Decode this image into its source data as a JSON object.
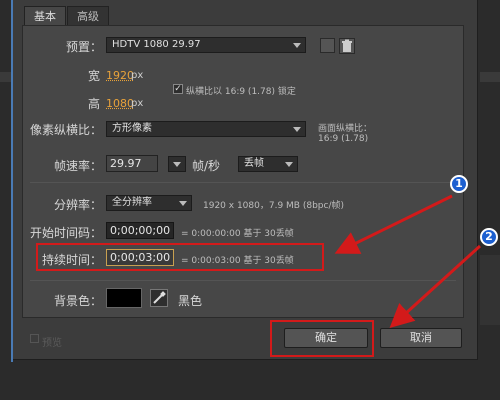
{
  "tabs": [
    "基本",
    "高级"
  ],
  "preset": {
    "label": "预置：",
    "value": "HDTV 1080 29.97"
  },
  "width": {
    "label": "宽",
    "value": "1920",
    "unit": "px"
  },
  "height": {
    "label": "高",
    "value": "1080",
    "unit": "px"
  },
  "lock_aspect": {
    "checked": "✓",
    "label": "纵横比以 16:9 (1.78) 锁定"
  },
  "pixel_aspect": {
    "label": "像素纵横比：",
    "value": "方形像素",
    "frame_aspect_label": "画面纵横比：",
    "frame_aspect_value": "16:9 (1.78)"
  },
  "frame_rate": {
    "label": "帧速率：",
    "value": "29.97",
    "unit": "帧/秒",
    "drop_frame": "丢帧"
  },
  "resolution": {
    "label": "分辨率：",
    "value": "全分辨率",
    "info": "1920 x 1080，7.9 MB (8bpc/帧)"
  },
  "start_timecode": {
    "label": "开始时间码：",
    "value": "0;00;00;00",
    "info": "= 0:00:00:00 基于 30丢帧"
  },
  "duration": {
    "label": "持续时间：",
    "value": "0;00;03;00",
    "info": "= 0:00:03:00 基于 30丢帧"
  },
  "background": {
    "label": "背景色：",
    "color": "#000000",
    "color_name": "黑色"
  },
  "preview_label": "预览",
  "buttons": {
    "ok": "确定",
    "cancel": "取消"
  },
  "annotations": {
    "badge1": "1",
    "badge2": "2",
    "red_color": "#d31a1a"
  }
}
